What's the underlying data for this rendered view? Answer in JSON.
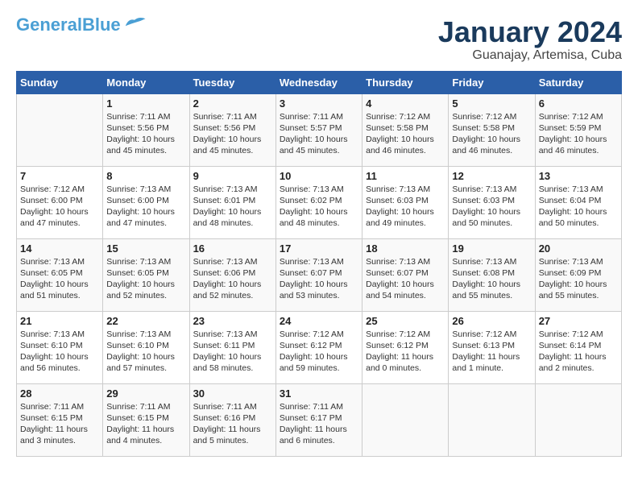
{
  "header": {
    "logo_line1": "General",
    "logo_line2": "Blue",
    "month": "January 2024",
    "location": "Guanajay, Artemisa, Cuba"
  },
  "columns": [
    "Sunday",
    "Monday",
    "Tuesday",
    "Wednesday",
    "Thursday",
    "Friday",
    "Saturday"
  ],
  "weeks": [
    [
      {
        "day": "",
        "info": ""
      },
      {
        "day": "1",
        "info": "Sunrise: 7:11 AM\nSunset: 5:56 PM\nDaylight: 10 hours\nand 45 minutes."
      },
      {
        "day": "2",
        "info": "Sunrise: 7:11 AM\nSunset: 5:56 PM\nDaylight: 10 hours\nand 45 minutes."
      },
      {
        "day": "3",
        "info": "Sunrise: 7:11 AM\nSunset: 5:57 PM\nDaylight: 10 hours\nand 45 minutes."
      },
      {
        "day": "4",
        "info": "Sunrise: 7:12 AM\nSunset: 5:58 PM\nDaylight: 10 hours\nand 46 minutes."
      },
      {
        "day": "5",
        "info": "Sunrise: 7:12 AM\nSunset: 5:58 PM\nDaylight: 10 hours\nand 46 minutes."
      },
      {
        "day": "6",
        "info": "Sunrise: 7:12 AM\nSunset: 5:59 PM\nDaylight: 10 hours\nand 46 minutes."
      }
    ],
    [
      {
        "day": "7",
        "info": "Sunrise: 7:12 AM\nSunset: 6:00 PM\nDaylight: 10 hours\nand 47 minutes."
      },
      {
        "day": "8",
        "info": "Sunrise: 7:13 AM\nSunset: 6:00 PM\nDaylight: 10 hours\nand 47 minutes."
      },
      {
        "day": "9",
        "info": "Sunrise: 7:13 AM\nSunset: 6:01 PM\nDaylight: 10 hours\nand 48 minutes."
      },
      {
        "day": "10",
        "info": "Sunrise: 7:13 AM\nSunset: 6:02 PM\nDaylight: 10 hours\nand 48 minutes."
      },
      {
        "day": "11",
        "info": "Sunrise: 7:13 AM\nSunset: 6:03 PM\nDaylight: 10 hours\nand 49 minutes."
      },
      {
        "day": "12",
        "info": "Sunrise: 7:13 AM\nSunset: 6:03 PM\nDaylight: 10 hours\nand 50 minutes."
      },
      {
        "day": "13",
        "info": "Sunrise: 7:13 AM\nSunset: 6:04 PM\nDaylight: 10 hours\nand 50 minutes."
      }
    ],
    [
      {
        "day": "14",
        "info": "Sunrise: 7:13 AM\nSunset: 6:05 PM\nDaylight: 10 hours\nand 51 minutes."
      },
      {
        "day": "15",
        "info": "Sunrise: 7:13 AM\nSunset: 6:05 PM\nDaylight: 10 hours\nand 52 minutes."
      },
      {
        "day": "16",
        "info": "Sunrise: 7:13 AM\nSunset: 6:06 PM\nDaylight: 10 hours\nand 52 minutes."
      },
      {
        "day": "17",
        "info": "Sunrise: 7:13 AM\nSunset: 6:07 PM\nDaylight: 10 hours\nand 53 minutes."
      },
      {
        "day": "18",
        "info": "Sunrise: 7:13 AM\nSunset: 6:07 PM\nDaylight: 10 hours\nand 54 minutes."
      },
      {
        "day": "19",
        "info": "Sunrise: 7:13 AM\nSunset: 6:08 PM\nDaylight: 10 hours\nand 55 minutes."
      },
      {
        "day": "20",
        "info": "Sunrise: 7:13 AM\nSunset: 6:09 PM\nDaylight: 10 hours\nand 55 minutes."
      }
    ],
    [
      {
        "day": "21",
        "info": "Sunrise: 7:13 AM\nSunset: 6:10 PM\nDaylight: 10 hours\nand 56 minutes."
      },
      {
        "day": "22",
        "info": "Sunrise: 7:13 AM\nSunset: 6:10 PM\nDaylight: 10 hours\nand 57 minutes."
      },
      {
        "day": "23",
        "info": "Sunrise: 7:13 AM\nSunset: 6:11 PM\nDaylight: 10 hours\nand 58 minutes."
      },
      {
        "day": "24",
        "info": "Sunrise: 7:12 AM\nSunset: 6:12 PM\nDaylight: 10 hours\nand 59 minutes."
      },
      {
        "day": "25",
        "info": "Sunrise: 7:12 AM\nSunset: 6:12 PM\nDaylight: 11 hours\nand 0 minutes."
      },
      {
        "day": "26",
        "info": "Sunrise: 7:12 AM\nSunset: 6:13 PM\nDaylight: 11 hours\nand 1 minute."
      },
      {
        "day": "27",
        "info": "Sunrise: 7:12 AM\nSunset: 6:14 PM\nDaylight: 11 hours\nand 2 minutes."
      }
    ],
    [
      {
        "day": "28",
        "info": "Sunrise: 7:11 AM\nSunset: 6:15 PM\nDaylight: 11 hours\nand 3 minutes."
      },
      {
        "day": "29",
        "info": "Sunrise: 7:11 AM\nSunset: 6:15 PM\nDaylight: 11 hours\nand 4 minutes."
      },
      {
        "day": "30",
        "info": "Sunrise: 7:11 AM\nSunset: 6:16 PM\nDaylight: 11 hours\nand 5 minutes."
      },
      {
        "day": "31",
        "info": "Sunrise: 7:11 AM\nSunset: 6:17 PM\nDaylight: 11 hours\nand 6 minutes."
      },
      {
        "day": "",
        "info": ""
      },
      {
        "day": "",
        "info": ""
      },
      {
        "day": "",
        "info": ""
      }
    ]
  ]
}
